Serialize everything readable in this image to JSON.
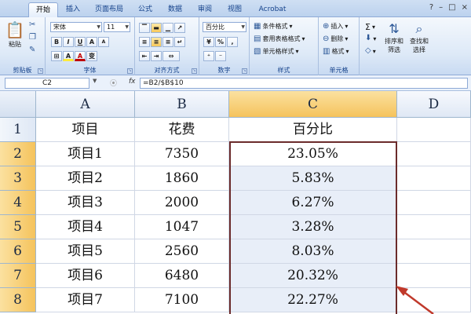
{
  "tabs": [
    "开始",
    "插入",
    "页面布局",
    "公式",
    "数据",
    "审阅",
    "视图",
    "Acrobat"
  ],
  "active_tab": 0,
  "window_controls": [
    "?",
    "–",
    "□",
    "×"
  ],
  "ribbon": {
    "clipboard": {
      "paste": "粘贴",
      "label": "剪贴板"
    },
    "font": {
      "name": "宋体",
      "size": "11",
      "bold": "B",
      "italic": "I",
      "underline": "U",
      "grow": "A",
      "shrink": "A",
      "fill": "A",
      "color": "A",
      "phonetic": "变",
      "label": "字体"
    },
    "align": {
      "label": "对齐方式"
    },
    "number": {
      "format": "百分比",
      "pct": "%",
      "comma": ",",
      "label": "数字"
    },
    "styles": {
      "conditional": "条件格式",
      "as_table": "套用表格格式",
      "cell_styles": "单元格样式",
      "label": "样式"
    },
    "cells": {
      "insert": "插入",
      "delete": "删除",
      "format": "格式",
      "label": "单元格"
    },
    "editing": {
      "sigma": "Σ",
      "sort": "排序和",
      "sort2": "筛选",
      "find": "查找和",
      "find2": "选择"
    }
  },
  "formula_bar": {
    "name_box": "C2",
    "fx": "fx",
    "formula": "=B2/$B$10"
  },
  "columns": [
    "A",
    "B",
    "C",
    "D"
  ],
  "selected_column": "C",
  "rows": [
    {
      "num": "1",
      "a": "项目",
      "b": "花费",
      "c": "百分比"
    },
    {
      "num": "2",
      "a": "项目1",
      "b": "7350",
      "c": "23.05%"
    },
    {
      "num": "3",
      "a": "项目2",
      "b": "1860",
      "c": "5.83%"
    },
    {
      "num": "4",
      "a": "项目3",
      "b": "2000",
      "c": "6.27%"
    },
    {
      "num": "5",
      "a": "项目4",
      "b": "1047",
      "c": "3.28%"
    },
    {
      "num": "6",
      "a": "项目5",
      "b": "2560",
      "c": "8.03%"
    },
    {
      "num": "7",
      "a": "项目6",
      "b": "6480",
      "c": "20.32%"
    },
    {
      "num": "8",
      "a": "项目7",
      "b": "7100",
      "c": "22.27%"
    }
  ],
  "colors": {
    "selection_border": "#6b2b2b",
    "arrow": "#c0392b",
    "selected_header": "#f5c35c"
  }
}
